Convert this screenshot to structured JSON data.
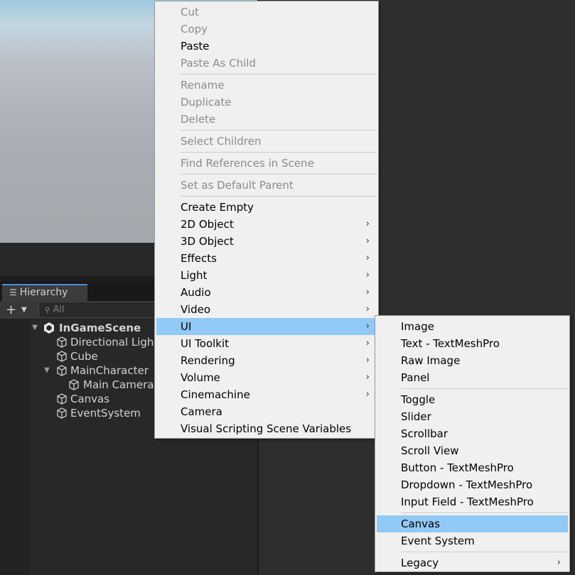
{
  "hierarchy": {
    "tab_label": "Hierarchy",
    "search_placeholder": "All",
    "add_label": "+",
    "items": [
      {
        "label": "InGameScene",
        "kind": "scene",
        "expanded": true
      },
      {
        "label": "Directional Light",
        "kind": "object"
      },
      {
        "label": "Cube",
        "kind": "object"
      },
      {
        "label": "MainCharacter",
        "kind": "object",
        "expanded": true
      },
      {
        "label": "Main Camera",
        "kind": "object"
      },
      {
        "label": "Canvas",
        "kind": "object"
      },
      {
        "label": "EventSystem",
        "kind": "object"
      }
    ]
  },
  "context_menu": {
    "items": [
      {
        "label": "Cut",
        "disabled": true
      },
      {
        "label": "Copy",
        "disabled": true
      },
      {
        "label": "Paste",
        "disabled": false
      },
      {
        "label": "Paste As Child",
        "disabled": true
      },
      {
        "label": "Rename",
        "disabled": true
      },
      {
        "label": "Duplicate",
        "disabled": true
      },
      {
        "label": "Delete",
        "disabled": true
      },
      {
        "label": "Select Children",
        "disabled": true
      },
      {
        "label": "Find References in Scene",
        "disabled": true
      },
      {
        "label": "Set as Default Parent",
        "disabled": true
      },
      {
        "label": "Create Empty",
        "disabled": false
      },
      {
        "label": "2D Object",
        "submenu": true
      },
      {
        "label": "3D Object",
        "submenu": true
      },
      {
        "label": "Effects",
        "submenu": true
      },
      {
        "label": "Light",
        "submenu": true
      },
      {
        "label": "Audio",
        "submenu": true
      },
      {
        "label": "Video",
        "submenu": true
      },
      {
        "label": "UI",
        "submenu": true,
        "active": true
      },
      {
        "label": "UI Toolkit",
        "submenu": true
      },
      {
        "label": "Rendering",
        "submenu": true
      },
      {
        "label": "Volume",
        "submenu": true
      },
      {
        "label": "Cinemachine",
        "submenu": true
      },
      {
        "label": "Camera",
        "disabled": false
      },
      {
        "label": "Visual Scripting Scene Variables",
        "disabled": false
      }
    ]
  },
  "ui_submenu": {
    "items": [
      {
        "label": "Image"
      },
      {
        "label": "Text - TextMeshPro"
      },
      {
        "label": "Raw Image"
      },
      {
        "label": "Panel"
      },
      {
        "label": "Toggle"
      },
      {
        "label": "Slider"
      },
      {
        "label": "Scrollbar"
      },
      {
        "label": "Scroll View"
      },
      {
        "label": "Button - TextMeshPro"
      },
      {
        "label": "Dropdown - TextMeshPro"
      },
      {
        "label": "Input Field - TextMeshPro"
      },
      {
        "label": "Canvas",
        "active": true
      },
      {
        "label": "Event System"
      },
      {
        "label": "Legacy",
        "submenu": true
      }
    ]
  },
  "colors": {
    "menu_bg": "#f0f0f0",
    "highlight": "#91c9f7",
    "editor_bg": "#282828",
    "disabled_text": "#8b8b8b"
  }
}
